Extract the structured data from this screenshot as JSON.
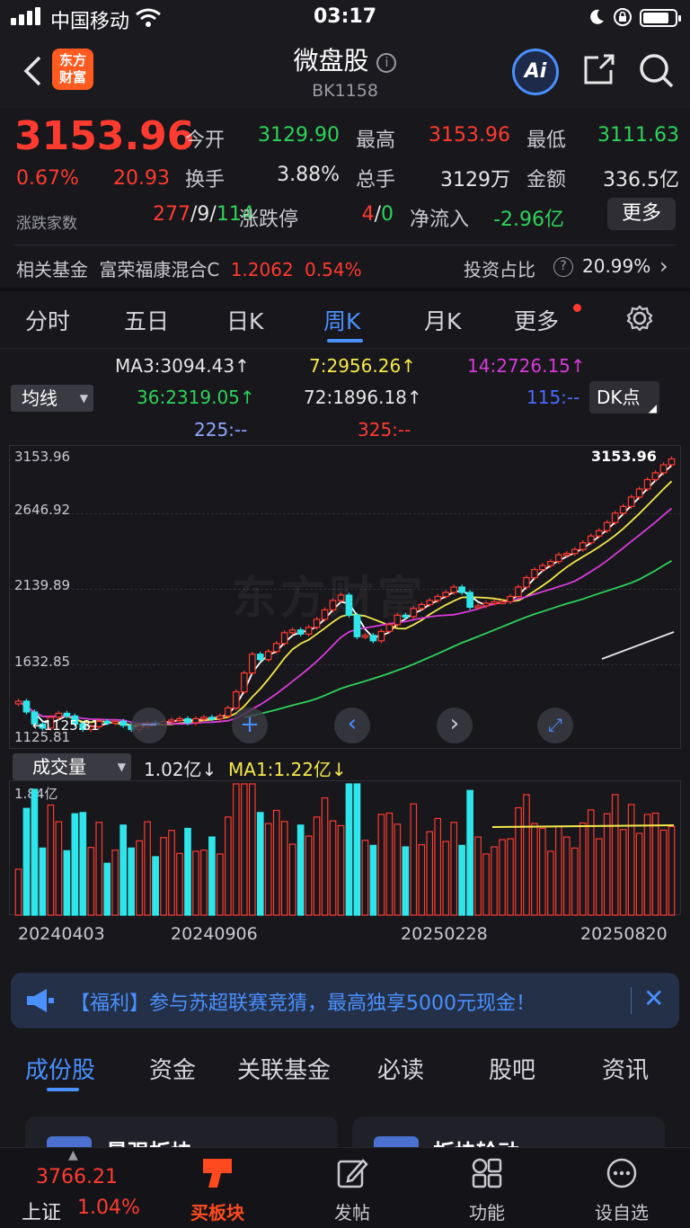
{
  "status_bar": {
    "carrier": "中国移动",
    "time": "03:17"
  },
  "header": {
    "title": "微盘股",
    "code": "BK1158",
    "logo_text_1": "东方",
    "logo_text_2": "财富",
    "ai_label": "Ai"
  },
  "quote": {
    "price": "3153.96",
    "change_pct": "0.67%",
    "change": "20.93",
    "open_label": "今开",
    "open": "3129.90",
    "high_label": "最高",
    "high": "3153.96",
    "low_label": "最低",
    "low": "3111.63",
    "turnover_label": "换手",
    "turnover": "3.88%",
    "volume_label": "总手",
    "volume": "3129万",
    "amount_label": "金额",
    "amount": "336.5亿",
    "breadth_label": "涨跌家数",
    "up": "277",
    "flat": "9",
    "down": "114",
    "sep": "/",
    "limit_label": "涨跌停",
    "limit_up": "4",
    "limit_down": "0",
    "netflow_label": "净流入",
    "netflow": "-2.96亿",
    "more_button": "更多"
  },
  "fund": {
    "label": "相关基金",
    "name": "富荣福康混合C",
    "nav": "1.2062",
    "pct": "0.54%",
    "ratio_label": "投资占比",
    "ratio": "20.99%"
  },
  "chart_tabs": [
    "分时",
    "五日",
    "日K",
    "周K",
    "月K",
    "更多"
  ],
  "active_tab_index": 3,
  "ma": {
    "selector": "均线",
    "ma3": "MA3:3094.43↑",
    "ma7": "7:2956.26↑",
    "ma14": "14:2726.15↑",
    "ma36": "36:2319.05↑",
    "ma72": "72:1896.18↑",
    "ma115": "115:--",
    "ma225": "225:--",
    "ma325": "325:--",
    "dk_button": "DK点"
  },
  "chart_data": {
    "type": "candlestick",
    "y_ticks": [
      "3153.96",
      "2646.92",
      "2139.89",
      "1632.85",
      "1125.81"
    ],
    "ylim": [
      1125.81,
      3153.96
    ],
    "last_price_label": "3153.96",
    "low_marker_label": "1125.81",
    "watermark": "东方财富",
    "x_labels": [
      "20240403",
      "20240906",
      "20250228",
      "20250820"
    ],
    "close": [
      1350,
      1270,
      1180,
      1150,
      1230,
      1260,
      1240,
      1180,
      1140,
      1160,
      1200,
      1190,
      1200,
      1170,
      1140,
      1160,
      1190,
      1180,
      1200,
      1210,
      1220,
      1190,
      1220,
      1230,
      1220,
      1240,
      1300,
      1420,
      1560,
      1700,
      1660,
      1720,
      1780,
      1860,
      1880,
      1850,
      1900,
      1960,
      2030,
      2100,
      2140,
      1990,
      1830,
      1840,
      1800,
      1870,
      1920,
      1990,
      1980,
      2040,
      2070,
      2100,
      2130,
      2160,
      2200,
      2160,
      2050,
      2060,
      2080,
      2090,
      2090,
      2130,
      2200,
      2270,
      2330,
      2360,
      2390,
      2440,
      2450,
      2480,
      2530,
      2580,
      2620,
      2680,
      2750,
      2800,
      2870,
      2930,
      3000,
      3050,
      3110,
      3154
    ]
  },
  "volume": {
    "selector": "成交量",
    "value": "1.02亿↓",
    "ma1": "MA1:1.22亿↓",
    "max_label": "1.84亿"
  },
  "banner": {
    "text": "【福利】参与苏超联赛竞猜，最高独享5000元现金！"
  },
  "bottom_tabs": [
    "成份股",
    "资金",
    "关联基金",
    "必读",
    "股吧",
    "资讯"
  ],
  "cards": [
    "最强板块",
    "板块轮动"
  ],
  "tab_bar": {
    "index_value": "3766.21",
    "index_name": "上证",
    "index_pct": "1.04%",
    "buy_label": "买板块",
    "post_label": "发帖",
    "func_label": "功能",
    "watch_label": "设自选"
  },
  "colors": {
    "up": "#ff3b30",
    "down": "#2fd35a",
    "accent": "#4a90ff",
    "cyan": "#2ee6ea"
  }
}
